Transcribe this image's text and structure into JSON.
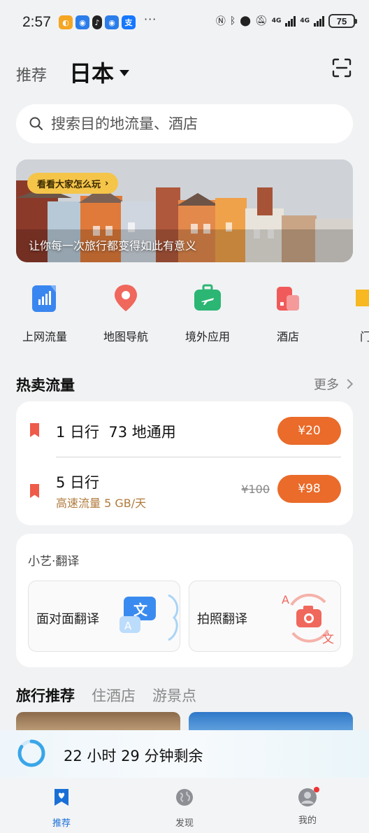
{
  "status_bar": {
    "time": "2:57",
    "more": "···",
    "network_1": "4G",
    "network_2": "4G",
    "battery": "75"
  },
  "header": {
    "tab_recommend": "推荐",
    "region": "日本"
  },
  "search": {
    "placeholder": "搜索目的地流量、酒店"
  },
  "banner": {
    "pill_label": "看看大家怎么玩",
    "caption": "让你每一次旅行都变得如此有意义"
  },
  "entries": [
    {
      "label": "上网流量",
      "icon": "signal-bars-icon"
    },
    {
      "label": "地图导航",
      "icon": "map-pin-icon"
    },
    {
      "label": "境外应用",
      "icon": "suitcase-plane-icon"
    },
    {
      "label": "酒店",
      "icon": "hotel-building-icon"
    },
    {
      "label": "门",
      "icon": "ticket-icon"
    }
  ],
  "hot_data": {
    "title": "热卖流量",
    "more": "更多",
    "plans": [
      {
        "name": "1 日行  73 地通用",
        "price": "¥20"
      },
      {
        "name": "5 日行",
        "sub": "高速流量 5 GB/天",
        "old_price": "¥100",
        "price": "¥98"
      }
    ]
  },
  "translate": {
    "title": "小艺·翻译",
    "face_to_face": "面对面翻译",
    "photo": "拍照翻译",
    "glyph_wen": "文",
    "glyph_a": "A"
  },
  "travel": {
    "tabs": [
      "旅行推荐",
      "住酒店",
      "游景点"
    ]
  },
  "countdown": {
    "text": "22 小时 29 分钟剩余"
  },
  "bottom_nav": [
    {
      "label": "推荐",
      "active": true
    },
    {
      "label": "发现",
      "active": false
    },
    {
      "label": "我的",
      "active": false
    }
  ],
  "colors": {
    "accent_orange": "#ea6b2a",
    "bookmark_red": "#ee5b49",
    "nav_active": "#1a6fd6",
    "pill_yellow": "#f5c54a"
  }
}
